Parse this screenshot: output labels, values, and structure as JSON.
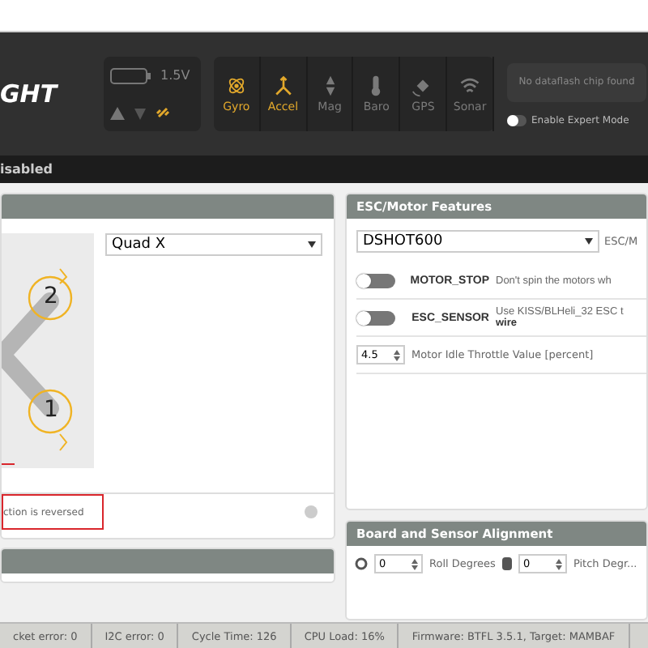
{
  "header": {
    "logo": "GHT",
    "battery": {
      "voltage": "1.5V"
    },
    "sensors": [
      {
        "label": "Gyro",
        "active": true,
        "kind": "gyro"
      },
      {
        "label": "Accel",
        "active": true,
        "kind": "accel"
      },
      {
        "label": "Mag",
        "active": false,
        "kind": "mag"
      },
      {
        "label": "Baro",
        "active": false,
        "kind": "baro"
      },
      {
        "label": "GPS",
        "active": false,
        "kind": "gps"
      },
      {
        "label": "Sonar",
        "active": false,
        "kind": "sonar"
      }
    ],
    "dataflash": "No dataflash chip found",
    "expert_mode": {
      "label": "Enable Expert Mode",
      "on": false
    }
  },
  "arming_status": "isabled",
  "mixer": {
    "motor_numbers": [
      "2",
      "1"
    ],
    "mixer_select": "Quad X",
    "note": "ction is reversed"
  },
  "esc": {
    "title": "ESC/Motor Features",
    "protocol": "DSHOT600",
    "protocol_label": "ESC/M",
    "features": [
      {
        "name": "MOTOR_STOP",
        "description": "Don't spin the motors wh",
        "on": false
      },
      {
        "name": "ESC_SENSOR",
        "description": "Use KISS/BLHeli_32 ESC t",
        "description_bold": "wire",
        "on": false
      }
    ],
    "idle_value": "4.5",
    "idle_label": "Motor Idle Throttle Value [percent]"
  },
  "alignment": {
    "title": "Board and Sensor Alignment",
    "roll_value": "0",
    "roll_label": "Roll Degrees",
    "pitch_value": "0",
    "pitch_label": "Pitch Degr..."
  },
  "status_bar": [
    "cket error: 0",
    "I2C error: 0",
    "Cycle Time: 126",
    "CPU Load: 16%",
    "Firmware: BTFL 3.5.1, Target: MAMBAF"
  ]
}
